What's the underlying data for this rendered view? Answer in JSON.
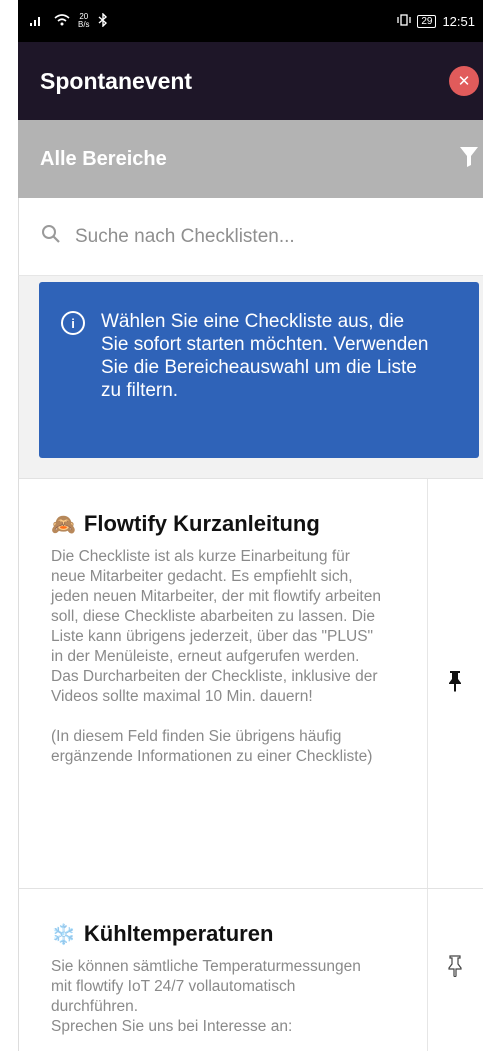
{
  "statusbar": {
    "speed_value": "20",
    "speed_unit": "B/s",
    "battery": "29",
    "time": "12:51"
  },
  "appbar": {
    "title": "Spontanevent",
    "close_icon": "close-icon"
  },
  "filter": {
    "label": "Alle Bereiche",
    "icon": "filter-icon"
  },
  "search": {
    "placeholder": "Suche nach Checklisten..."
  },
  "info": {
    "text": "Wählen Sie eine Checkliste aus, die Sie sofort starten möchten. Verwenden Sie die Bereicheauswahl um die Liste zu filtern."
  },
  "checklists": [
    {
      "emoji": "🙈",
      "title": "Flowtify Kurzanleitung",
      "description": "Die Checkliste ist als kurze Einarbeitung für neue Mitarbeiter gedacht. Es empfiehlt sich, jeden neuen Mitarbeiter, der mit flowtify arbeiten soll, diese Checkliste abarbeiten zu lassen. Die Liste kann übrigens jederzeit, über das \"PLUS\" in der Menüleiste, erneut aufgerufen werden.  Das Durcharbeiten der Checkliste, inklusive der Videos sollte maximal 10 Min. dauern!\n\n(In diesem Feld finden Sie übrigens häufig ergänzende Informationen zu einer Checkliste)",
      "pinned": true
    },
    {
      "emoji": "❄️",
      "title": "Kühltemperaturen",
      "description": "Sie können sämtliche Temperaturmessungen mit flowtify IoT 24/7 vollautomatisch durchführen.\nSprechen Sie uns bei Interesse an:",
      "pinned": false
    }
  ]
}
